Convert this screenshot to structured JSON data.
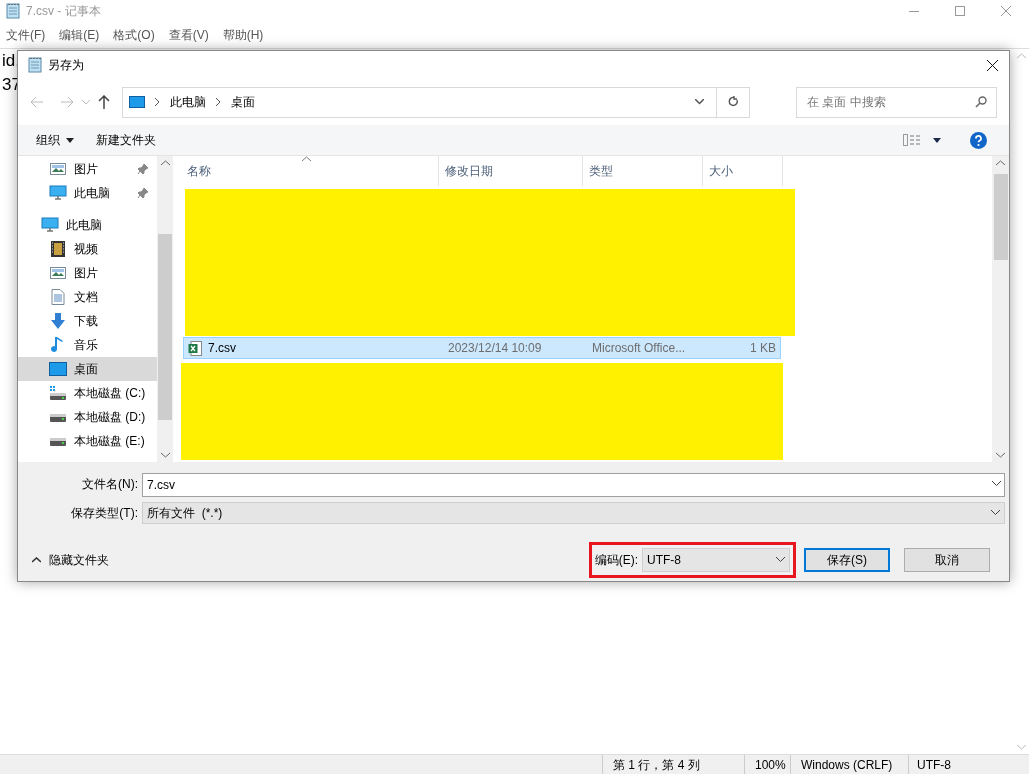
{
  "window": {
    "title": "7.csv - 记事本"
  },
  "menu": [
    "文件(F)",
    "编辑(E)",
    "格式(O)",
    "查看(V)",
    "帮助(H)"
  ],
  "editor_lines": [
    "id,",
    "37"
  ],
  "dialog": {
    "title": "另存为",
    "breadcrumb": [
      "此电脑",
      "桌面"
    ],
    "search": {
      "placeholder": "在 桌面 中搜索"
    },
    "toolbar": [
      "组织",
      "新建文件夹"
    ],
    "sidebar": [
      {
        "label": "图片",
        "kind": "pictures",
        "pinned": true,
        "selected": false
      },
      {
        "label": "此电脑",
        "kind": "computer",
        "pinned": true,
        "selected": false
      },
      {
        "label": "此电脑",
        "kind": "computer",
        "selected": false,
        "children": [
          {
            "label": "视频",
            "kind": "videos",
            "selected": false
          },
          {
            "label": "图片",
            "kind": "pictures",
            "selected": false
          },
          {
            "label": "文档",
            "kind": "documents",
            "selected": false
          },
          {
            "label": "下载",
            "kind": "downloads",
            "selected": false
          },
          {
            "label": "音乐",
            "kind": "music",
            "selected": false
          },
          {
            "label": "桌面",
            "kind": "desktop",
            "selected": true
          },
          {
            "label": "本地磁盘 (C:)",
            "kind": "system-drive",
            "selected": false
          },
          {
            "label": "本地磁盘 (D:)",
            "kind": "drive",
            "selected": false
          },
          {
            "label": "本地磁盘 (E:)",
            "kind": "drive",
            "selected": false
          }
        ]
      }
    ],
    "columns": [
      "名称",
      "修改日期",
      "类型",
      "大小"
    ],
    "files": [
      {
        "name": "7.csv",
        "modified": "2023/12/14 10:09",
        "type": "Microsoft Office...",
        "size": "1 KB",
        "selected": true
      }
    ],
    "filename": {
      "label": "文件名(N):",
      "value": "7.csv"
    },
    "filetype": {
      "label": "保存类型(T):",
      "value": "所有文件  (*.*)"
    },
    "hide_folders": "隐藏文件夹",
    "encoding": {
      "label": "编码(E):",
      "value": "UTF-8",
      "highlighted": true
    },
    "buttons": [
      "保存(S)",
      "取消"
    ]
  },
  "status_bar": [
    "第 1 行，第 4 列",
    "100%",
    "Windows (CRLF)",
    "UTF-8"
  ]
}
